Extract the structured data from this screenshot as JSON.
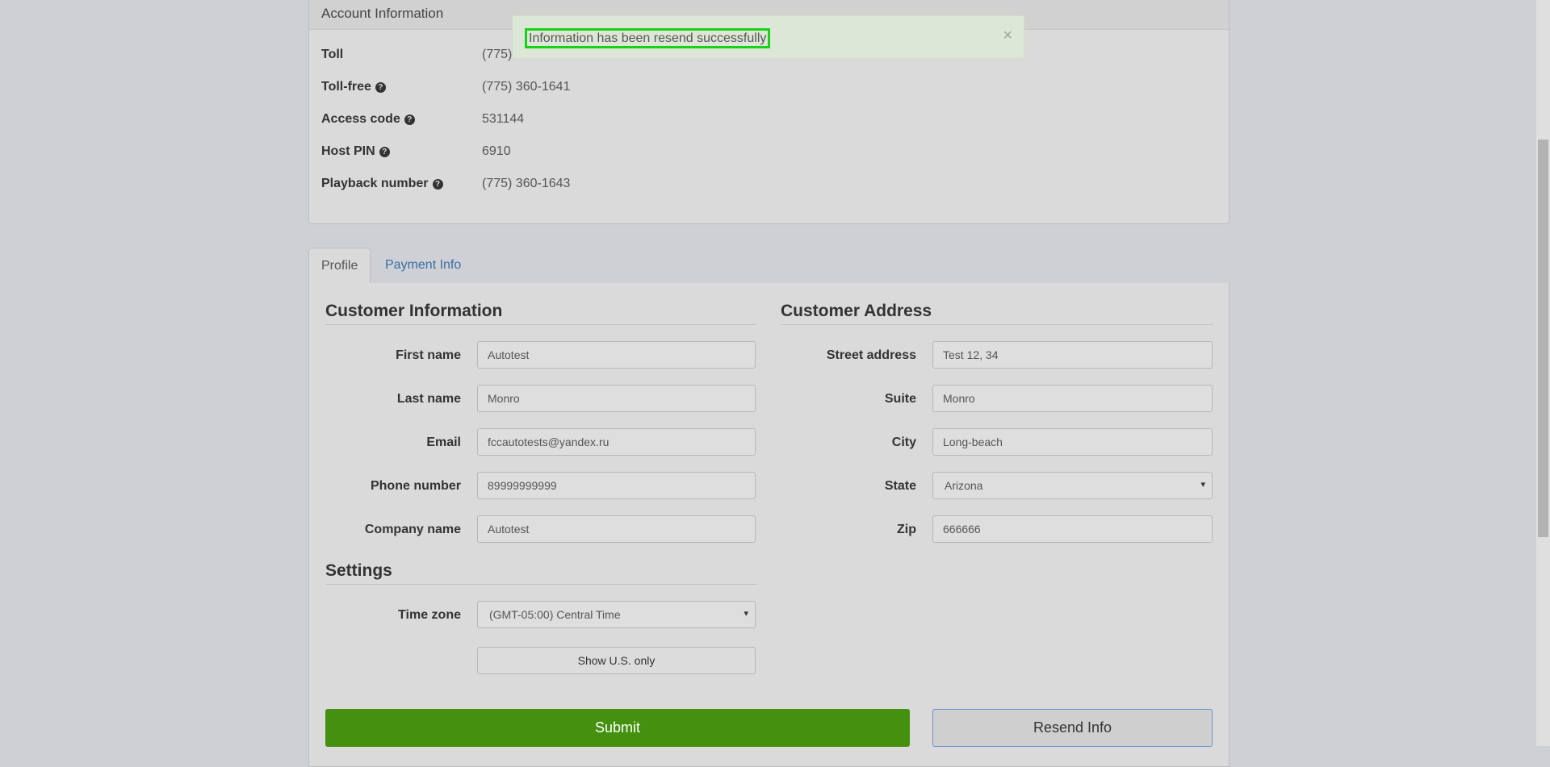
{
  "account": {
    "heading": "Account Information",
    "rows": [
      {
        "label": "Toll",
        "value": "(775) 360-1642"
      },
      {
        "label": "Toll-free",
        "value": "(775) 360-1641"
      },
      {
        "label": "Access code",
        "value": "531144"
      },
      {
        "label": "Host PIN",
        "value": "6910"
      },
      {
        "label": "Playback number",
        "value": "(775) 360-1643"
      }
    ],
    "help_glyph": "?"
  },
  "alert": {
    "message": "Information has been resend successfully",
    "close": "×"
  },
  "tabs": [
    {
      "label": "Profile",
      "active": true
    },
    {
      "label": "Payment Info",
      "active": false
    }
  ],
  "customer_info": {
    "title": "Customer Information",
    "fields": [
      {
        "label": "First name",
        "value": "Autotest"
      },
      {
        "label": "Last name",
        "value": "Monro"
      },
      {
        "label": "Email",
        "value": "fccautotests@yandex.ru"
      },
      {
        "label": "Phone number",
        "value": "89999999999"
      },
      {
        "label": "Company name",
        "value": "Autotest"
      }
    ]
  },
  "customer_address": {
    "title": "Customer Address",
    "fields": [
      {
        "label": "Street address",
        "value": "Test 12, 34"
      },
      {
        "label": "Suite",
        "value": "Monro"
      },
      {
        "label": "City",
        "value": "Long-beach"
      },
      {
        "label": "State",
        "value": "Arizona"
      },
      {
        "label": "Zip",
        "value": "666666"
      }
    ]
  },
  "settings": {
    "title": "Settings",
    "timezone_label": "Time zone",
    "timezone_value": "(GMT-05:00) Central Time",
    "show_us_only": "Show U.S. only"
  },
  "buttons": {
    "submit": "Submit",
    "resend": "Resend Info"
  },
  "select_arrow": "▾",
  "colors": {
    "submit_bg": "#44910f",
    "link": "#3a6ea5",
    "alert_bg": "#dde7d7",
    "highlight": "#1ad11a"
  }
}
